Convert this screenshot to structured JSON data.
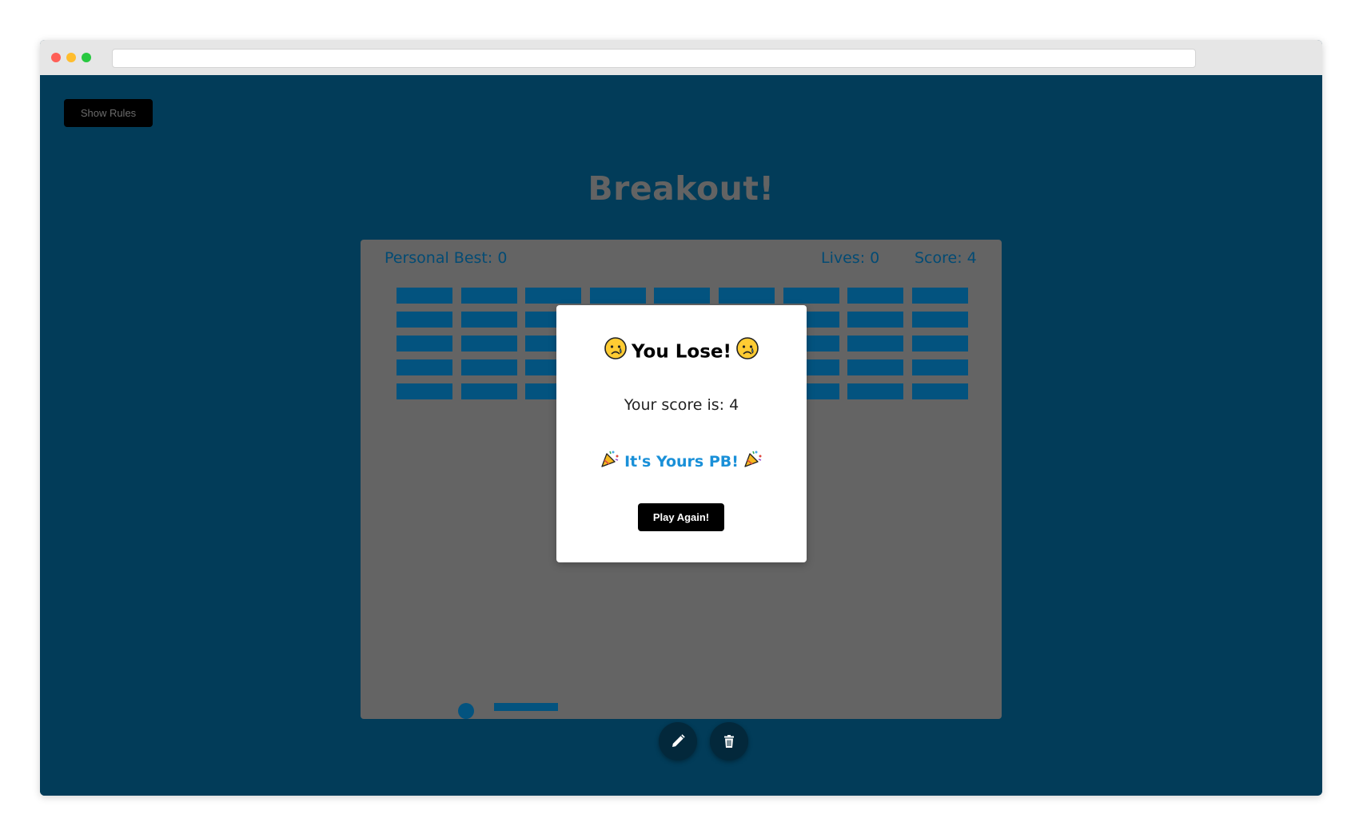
{
  "header": {
    "rules_button_label": "Show Rules",
    "title": "Breakout!"
  },
  "game": {
    "personal_best_label": "Personal Best: 0",
    "lives_label": "Lives: 0",
    "score_label": "Score: 4",
    "brick_grid": {
      "columns": 9,
      "rows": 5
    },
    "colors": {
      "page_background": "#023c59",
      "board_background": "#646464",
      "brick": "#03537f",
      "stat_text": "#034b74"
    }
  },
  "modal": {
    "title": "You Lose!",
    "title_emoji": "sad-crying-face-icon",
    "score_text": "Your score is: 4",
    "pb_text": "It's Yours PB!",
    "pb_emoji": "party-popper-icon",
    "pb_color": "#1a90d8",
    "play_again_label": "Play Again!"
  },
  "toolbar": {
    "edit_icon": "pencil-icon",
    "delete_icon": "trash-icon"
  }
}
